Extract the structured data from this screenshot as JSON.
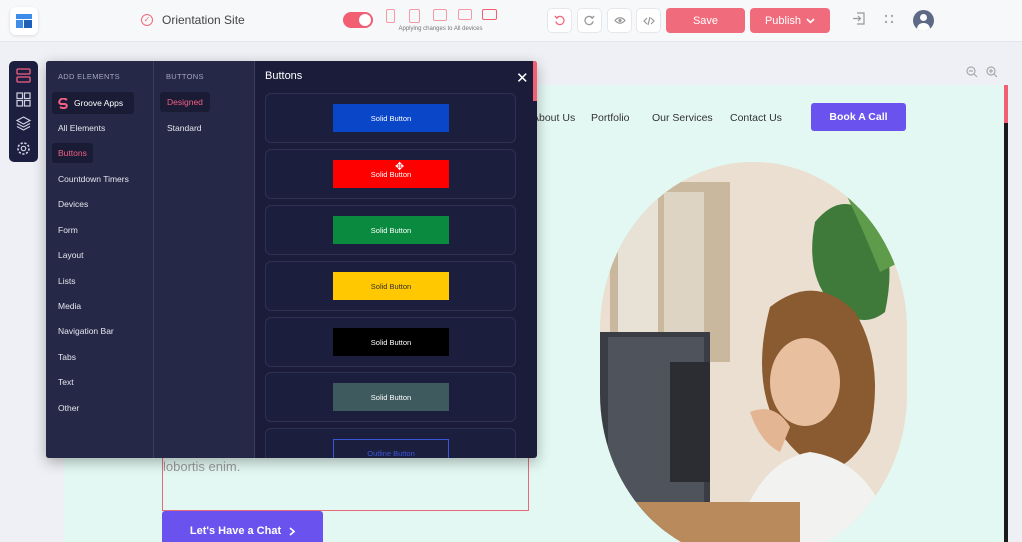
{
  "topbar": {
    "site_title": "Orientation Site",
    "apply_text": "Applying changes to All devices",
    "save_label": "Save",
    "publish_label": "Publish"
  },
  "panel": {
    "col1_header": "ADD ELEMENTS",
    "col1_items": [
      "Groove Apps",
      "All Elements",
      "Buttons",
      "Countdown Timers",
      "Devices",
      "Form",
      "Layout",
      "Lists",
      "Media",
      "Navigation Bar",
      "Tabs",
      "Text",
      "Other"
    ],
    "col2_header": "BUTTONS",
    "col2_items": [
      "Designed",
      "Standard"
    ],
    "preview_title": "Buttons",
    "cards": [
      {
        "label": "Solid Button",
        "color": "#0a46c8",
        "text_color": "#ffffff"
      },
      {
        "label": "Solid Button",
        "color": "#ff0000",
        "text_color": "#ffffff"
      },
      {
        "label": "Solid Button",
        "color": "#0a8a3e",
        "text_color": "#ffffff"
      },
      {
        "label": "Solid Button",
        "color": "#ffc800",
        "text_color": "#333333"
      },
      {
        "label": "Solid Button",
        "color": "#000000",
        "text_color": "#ffffff"
      },
      {
        "label": "Solid Button",
        "color": "#3f5a5e",
        "text_color": "#ffffff"
      },
      {
        "label": "Outline Button",
        "color": "transparent",
        "text_color": "#3a56d8"
      }
    ]
  },
  "site": {
    "nav": [
      "About Us",
      "Portfolio",
      "Our Services",
      "Contact Us"
    ],
    "book_btn": "Book A Call",
    "body_text": "lobortis enim.",
    "chat_btn": "Let's Have a Chat"
  },
  "colors": {
    "accent": "#f06b7c",
    "panel_bg": "#1a1c3a",
    "site_accent": "#6a52ee",
    "canvas_bg": "#e3f8f3"
  }
}
